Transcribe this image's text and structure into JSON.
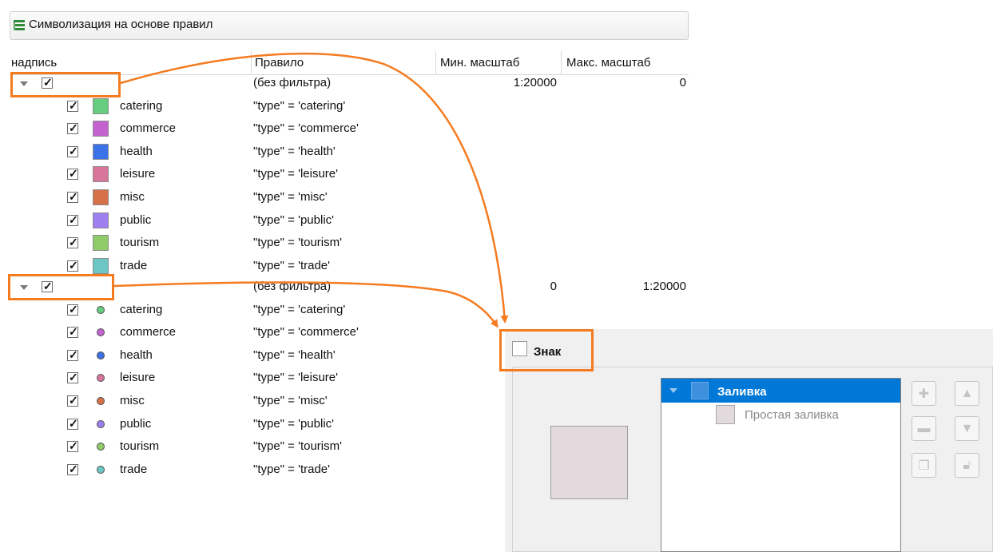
{
  "renderer": {
    "label": "Символизация на основе правил",
    "icon": "rule-based-renderer-icon"
  },
  "columns": {
    "label": "надпись",
    "rule": "Правило",
    "min_scale": "Мин. масштаб",
    "max_scale": "Макс. масштаб"
  },
  "groups": [
    {
      "filter": "(без фильтра)",
      "min_scale": "1:20000",
      "max_scale": "0",
      "symbol_kind": "fill",
      "rules": [
        {
          "label": "catering",
          "expr": "\"type\" = 'catering'",
          "color": "#66cc80"
        },
        {
          "label": "commerce",
          "expr": "\"type\" = 'commerce'",
          "color": "#c462cf"
        },
        {
          "label": "health",
          "expr": "\"type\" = 'health'",
          "color": "#3c72e8"
        },
        {
          "label": "leisure",
          "expr": "\"type\" = 'leisure'",
          "color": "#d7769a"
        },
        {
          "label": "misc",
          "expr": "\"type\" = 'misc'",
          "color": "#d77149"
        },
        {
          "label": "public",
          "expr": "\"type\" = 'public'",
          "color": "#9d7ff0"
        },
        {
          "label": "tourism",
          "expr": "\"type\" = 'tourism'",
          "color": "#90cb6a"
        },
        {
          "label": "trade",
          "expr": "\"type\" = 'trade'",
          "color": "#6cc7c4"
        }
      ]
    },
    {
      "filter": "(без фильтра)",
      "min_scale": "0",
      "max_scale": "1:20000",
      "symbol_kind": "marker",
      "rules": [
        {
          "label": "catering",
          "expr": "\"type\" = 'catering'",
          "color": "#66cc80"
        },
        {
          "label": "commerce",
          "expr": "\"type\" = 'commerce'",
          "color": "#c462cf"
        },
        {
          "label": "health",
          "expr": "\"type\" = 'health'",
          "color": "#3c72e8"
        },
        {
          "label": "leisure",
          "expr": "\"type\" = 'leisure'",
          "color": "#d7769a"
        },
        {
          "label": "misc",
          "expr": "\"type\" = 'misc'",
          "color": "#d77149"
        },
        {
          "label": "public",
          "expr": "\"type\" = 'public'",
          "color": "#9d7ff0"
        },
        {
          "label": "tourism",
          "expr": "\"type\" = 'tourism'",
          "color": "#90cb6a"
        },
        {
          "label": "trade",
          "expr": "\"type\" = 'trade'",
          "color": "#6cc7c4"
        }
      ]
    }
  ],
  "symbol_panel": {
    "title": "Знак",
    "layers": [
      {
        "label": "Заливка",
        "selected": true
      },
      {
        "label": "Простая заливка",
        "selected": false
      }
    ],
    "preview_color": "#e2dadc",
    "buttons": [
      "add-layer-icon",
      "move-up-icon",
      "remove-layer-icon",
      "move-down-icon",
      "duplicate-layer-icon",
      "lock-icon"
    ]
  },
  "annotation": {
    "color": "#f47b20"
  }
}
